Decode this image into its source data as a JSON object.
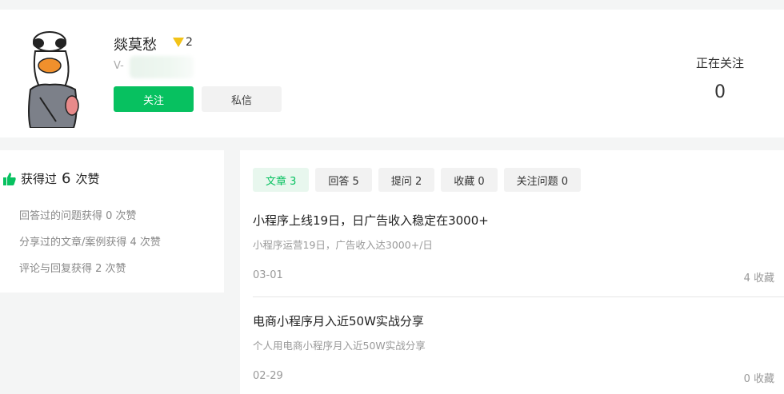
{
  "profile": {
    "username": "燚莫愁",
    "level": "2",
    "wechat_prefix": "V-",
    "follow_label": "关注",
    "message_label": "私信",
    "following_label": "正在关注",
    "following_count": "0"
  },
  "likes": {
    "prefix": "获得过",
    "count": "6",
    "suffix": "次赞",
    "lines": [
      "回答过的问题获得 0 次赞",
      "分享过的文章/案例获得 4 次赞",
      "评论与回复获得 2 次赞"
    ]
  },
  "tabs": [
    {
      "label": "文章 3",
      "active": true
    },
    {
      "label": "回答 5",
      "active": false
    },
    {
      "label": "提问 2",
      "active": false
    },
    {
      "label": "收藏 0",
      "active": false
    },
    {
      "label": "关注问题 0",
      "active": false
    }
  ],
  "articles": [
    {
      "title": "小程序上线19日，日广告收入稳定在3000+",
      "summary": "小程序运营19日，广告收入达3000+/日",
      "date": "03-01",
      "favorites": "4 收藏"
    },
    {
      "title": "电商小程序月入近50W实战分享",
      "summary": "个人用电商小程序月入近50W实战分享",
      "date": "02-29",
      "favorites": "0 收藏"
    }
  ],
  "colors": {
    "accent": "#07c160",
    "level_badge": "#f2c318"
  }
}
